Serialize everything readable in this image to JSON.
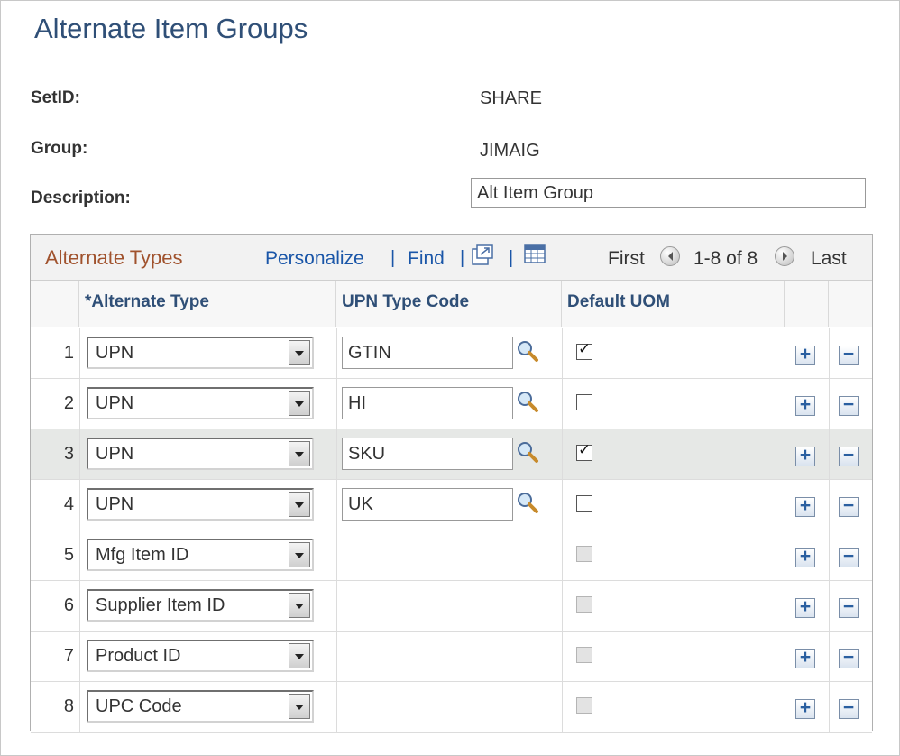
{
  "page": {
    "title": "Alternate Item Groups"
  },
  "fields": {
    "setid_label": "SetID:",
    "setid_value": "SHARE",
    "group_label": "Group:",
    "group_value": "JIMAIG",
    "description_label": "Description:",
    "description_value": "Alt Item Group"
  },
  "grid": {
    "title": "Alternate Types",
    "personalize": "Personalize",
    "find": "Find",
    "sep": "|",
    "first": "First",
    "range": "1-8 of 8",
    "last": "Last",
    "columns": {
      "alt_type": "*Alternate Type",
      "upn_code": "UPN Type Code",
      "default_uom": "Default UOM"
    },
    "rows": [
      {
        "num": "1",
        "type": "UPN",
        "code": "GTIN",
        "checked": true,
        "enabled": true,
        "highlight": false
      },
      {
        "num": "2",
        "type": "UPN",
        "code": "HI",
        "checked": false,
        "enabled": true,
        "highlight": false
      },
      {
        "num": "3",
        "type": "UPN",
        "code": "SKU",
        "checked": true,
        "enabled": true,
        "highlight": true
      },
      {
        "num": "4",
        "type": "UPN",
        "code": "UK",
        "checked": false,
        "enabled": true,
        "highlight": false
      },
      {
        "num": "5",
        "type": "Mfg Item ID",
        "code": null,
        "checked": false,
        "enabled": false,
        "highlight": false
      },
      {
        "num": "6",
        "type": "Supplier Item ID",
        "code": null,
        "checked": false,
        "enabled": false,
        "highlight": false
      },
      {
        "num": "7",
        "type": "Product ID",
        "code": null,
        "checked": false,
        "enabled": false,
        "highlight": false
      },
      {
        "num": "8",
        "type": "UPC Code",
        "code": null,
        "checked": false,
        "enabled": false,
        "highlight": false
      }
    ]
  },
  "icons": {
    "zoom": "zoom-grid-icon",
    "download": "download-grid-icon",
    "prev": "arrow-left-icon",
    "next": "arrow-right-icon",
    "lookup": "magnifier-icon",
    "add": "plus-icon",
    "delete": "minus-icon",
    "add_symbol": "+",
    "delete_symbol": "−",
    "check_symbol": "✓"
  },
  "colors": {
    "title": "#2f4f77",
    "link": "#1a56a8",
    "grid_title": "#a0522d",
    "highlight_row": "#e6e8e6"
  }
}
